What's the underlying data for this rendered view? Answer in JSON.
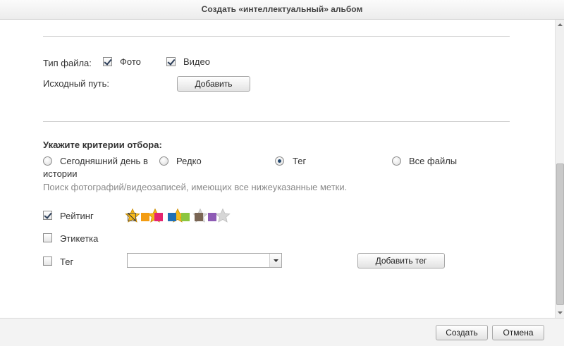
{
  "dialog": {
    "title": "Создать «интеллектуальный» альбом"
  },
  "file_type": {
    "label": "Тип файла:",
    "options": [
      {
        "label": "Фото",
        "checked": true
      },
      {
        "label": "Видео",
        "checked": true
      }
    ]
  },
  "source_path": {
    "label": "Исходный путь:",
    "add_button": "Добавить"
  },
  "criteria": {
    "heading": "Укажите критерии отбора:",
    "radios": [
      {
        "label_line1": "Сегодняшний день в",
        "label_line2": "истории",
        "checked": false
      },
      {
        "label": "Редко",
        "checked": false
      },
      {
        "label": "Тег",
        "checked": true
      },
      {
        "label": "Все файлы",
        "checked": false
      }
    ],
    "description": "Поиск фотографий/видеозаписей, имеющих все нижеуказанные метки."
  },
  "filters": {
    "rating": {
      "label": "Рейтинг",
      "checked": true,
      "value": 3,
      "max": 5
    },
    "label": {
      "label": "Этикетка",
      "checked": false,
      "colors": [
        "none",
        "#f39c12",
        "#e5256f",
        "#1f6fb5",
        "#8cc63f",
        "#7a6654",
        "#8e5bb5"
      ]
    },
    "tag": {
      "label": "Тег",
      "checked": false,
      "value": "",
      "add_button": "Добавить тег"
    }
  },
  "footer": {
    "create_button": "Создать",
    "cancel_button": "Отмена"
  },
  "colors": {
    "star_on": "#f5b819",
    "star_off": "#d6d6d6"
  }
}
